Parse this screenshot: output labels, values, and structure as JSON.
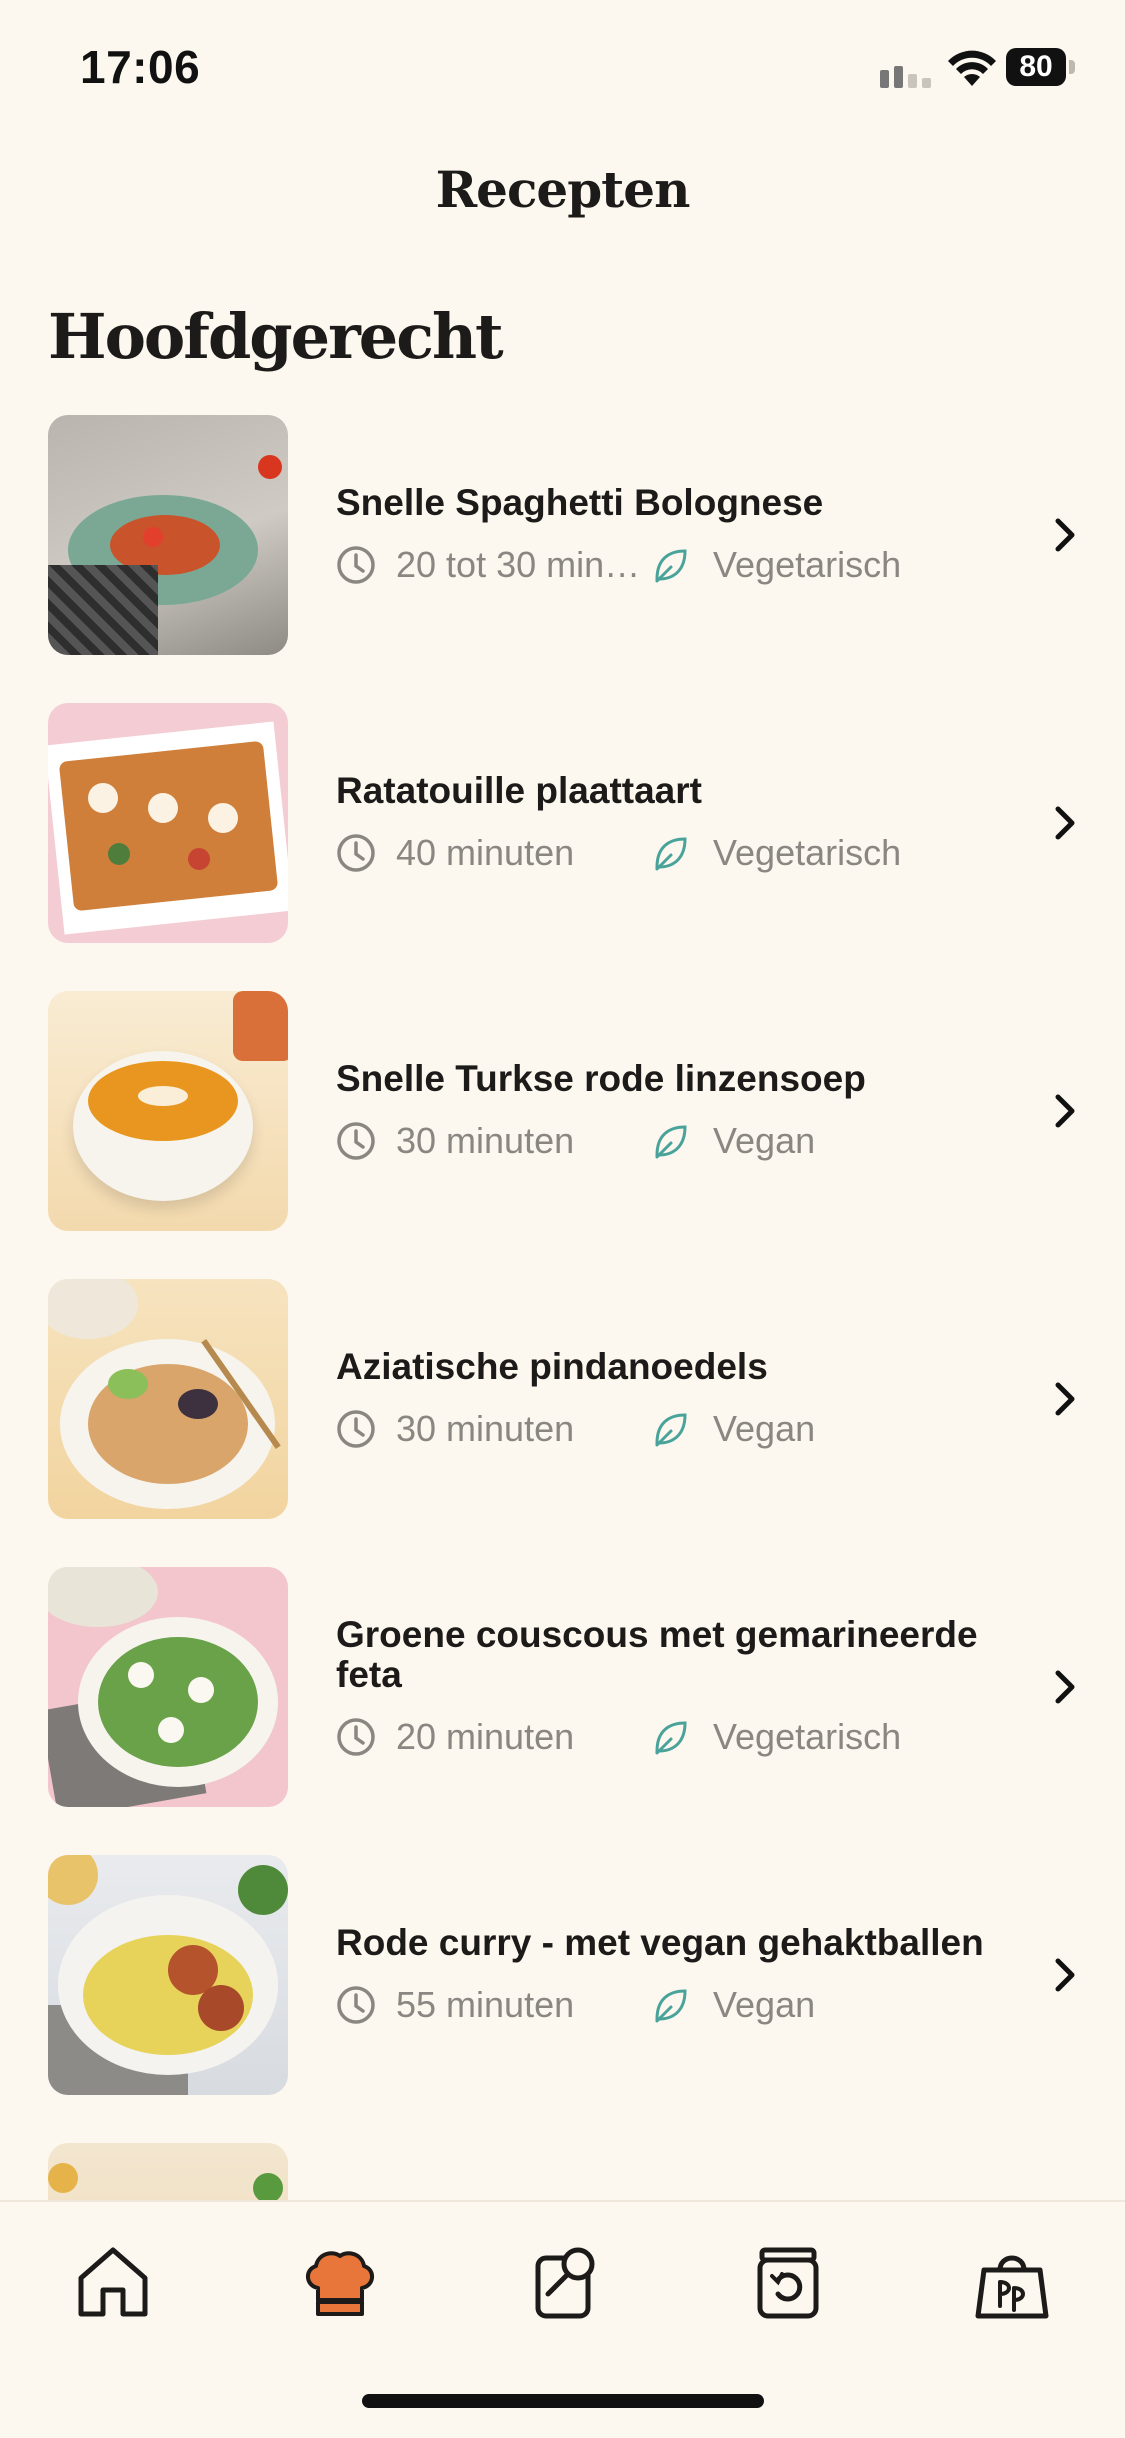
{
  "status_bar": {
    "time": "17:06",
    "battery": "80"
  },
  "header": {
    "title": "Recepten"
  },
  "section": {
    "title": "Hoofdgerecht"
  },
  "recipes": [
    {
      "title": "Snelle Spaghetti Bolognese",
      "duration": "20 tot 30 minut...",
      "diet": "Vegetarisch"
    },
    {
      "title": "Ratatouille plaattaart",
      "duration": "40 minuten",
      "diet": "Vegetarisch"
    },
    {
      "title": "Snelle Turkse rode linzensoep",
      "duration": "30 minuten",
      "diet": "Vegan"
    },
    {
      "title": "Aziatische pindanoedels",
      "duration": "30 minuten",
      "diet": "Vegan"
    },
    {
      "title": "Groene couscous met gemarineerde feta",
      "duration": "20 minuten",
      "diet": "Vegetarisch"
    },
    {
      "title": "Rode curry - met vegan gehaktballen",
      "duration": "55 minuten",
      "diet": "Vegan"
    }
  ],
  "tabbar": {
    "items": [
      {
        "icon": "home-icon"
      },
      {
        "icon": "chef-hat-icon",
        "active": true
      },
      {
        "icon": "search-recipe-icon"
      },
      {
        "icon": "history-icon"
      },
      {
        "icon": "shopping-bag-icon"
      }
    ]
  },
  "colors": {
    "accent": "#e8763a",
    "leaf": "#4aa39a",
    "background": "#fcf8ef",
    "text": "#1d1b19",
    "muted": "#8a8681"
  }
}
